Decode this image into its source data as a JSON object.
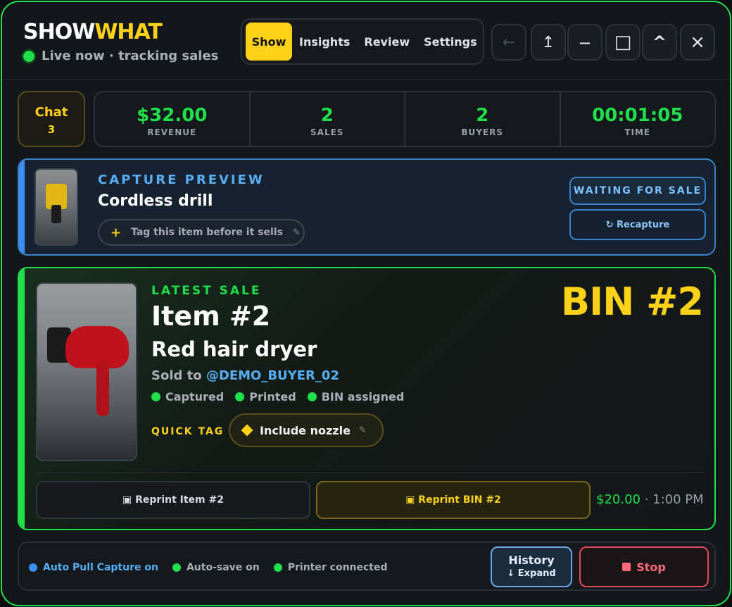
{
  "app": {
    "logo_part1": "SHOW",
    "logo_part2": "WHAT",
    "status": "Live now · tracking sales"
  },
  "tabs": [
    {
      "label": "Show",
      "active": true
    },
    {
      "label": "Insights",
      "active": false
    },
    {
      "label": "Review",
      "active": false
    },
    {
      "label": "Settings",
      "active": false
    }
  ],
  "window_controls": {
    "back_icon": "←",
    "share_icon": "↥",
    "minimize_icon": "—",
    "maximize_icon": "□",
    "collapse_icon": "^",
    "close_icon": "×"
  },
  "chat": {
    "label": "Chat",
    "count": "3"
  },
  "stats": [
    {
      "value": "$32.00",
      "label": "REVENUE"
    },
    {
      "value": "2",
      "label": "SALES"
    },
    {
      "value": "2",
      "label": "BUYERS"
    },
    {
      "value": "00:01:05",
      "label": "TIME"
    }
  ],
  "capture": {
    "title": "CAPTURE PREVIEW",
    "item": "Cordless drill",
    "tag_plus": "+",
    "tag_placeholder": "Tag this item before it sells",
    "tag_pencil": "✎",
    "status_button": "WAITING FOR SALE",
    "recapture_button": "↻ Recapture"
  },
  "latest_sale": {
    "label": "LATEST SALE",
    "item_number": "Item #2",
    "item_name": "Red hair dryer",
    "sold_to_prefix": "Sold to ",
    "buyer": "@DEMO_BUYER_02",
    "statuses": [
      "Captured",
      "Printed",
      "BIN assigned"
    ],
    "quick_tag_label": "QUICK TAG",
    "quick_tag_value": "Include nozzle",
    "quick_tag_pencil": "✎",
    "bin": "BIN #2",
    "reprint_item": "▣ Reprint Item #2",
    "reprint_bin": "▣ Reprint BIN #2",
    "price": "$20.00",
    "separator": " · ",
    "time": "1:00 PM"
  },
  "footer": {
    "flags": [
      "Auto Pull Capture on",
      "Auto-save on",
      "Printer connected"
    ],
    "history_label": "History",
    "history_sub": "↓ Expand",
    "stop_label": "Stop"
  },
  "colors": {
    "accent_green": "#1fe04c",
    "accent_yellow": "#ffd21a",
    "accent_blue": "#58aef5",
    "stop_red": "#ff6b7a"
  }
}
